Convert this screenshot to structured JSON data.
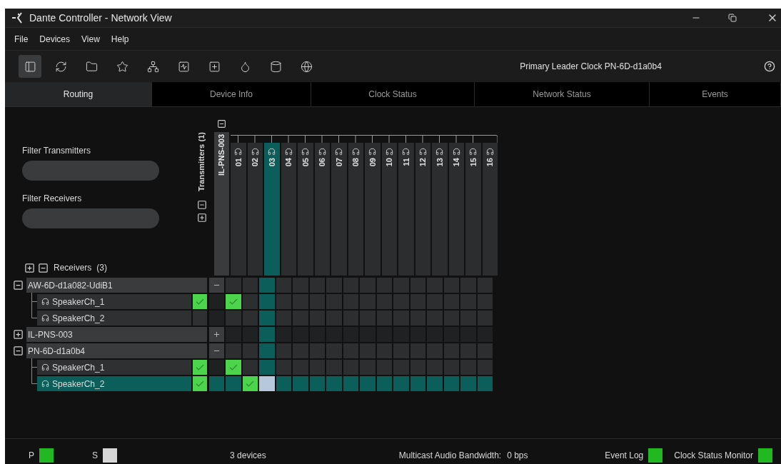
{
  "window": {
    "title": "Dante Controller - Network View"
  },
  "menu": [
    "File",
    "Devices",
    "View",
    "Help"
  ],
  "toolbar": {
    "tools": [
      {
        "kind": "panel",
        "selected": true
      },
      {
        "kind": "refresh",
        "selected": false
      },
      {
        "kind": "folder",
        "selected": false
      },
      {
        "kind": "star",
        "selected": false
      },
      {
        "kind": "network",
        "selected": false
      },
      {
        "kind": "monitor",
        "selected": false
      },
      {
        "kind": "add",
        "selected": false
      },
      {
        "kind": "drop",
        "selected": false
      },
      {
        "kind": "disc",
        "selected": false
      },
      {
        "kind": "globe",
        "selected": false
      }
    ],
    "clock_label": "Primary Leader Clock PN-6D-d1a0b4"
  },
  "tabs": [
    {
      "label": "Routing",
      "selected": true
    },
    {
      "label": "Device Info",
      "selected": false
    },
    {
      "label": "Clock Status",
      "selected": false
    },
    {
      "label": "Network Status",
      "selected": false
    },
    {
      "label": "Events",
      "selected": false
    }
  ],
  "filters": [
    {
      "label": "Filter Transmitters"
    },
    {
      "label": "Filter Receivers"
    }
  ],
  "transmitters": {
    "label": "Transmitters",
    "count": "(1)",
    "devices": [
      {
        "name": "IL-PNS-003",
        "expanded": true,
        "channels": [
          {
            "label": "01",
            "selected": false
          },
          {
            "label": "02",
            "selected": false
          },
          {
            "label": "03",
            "selected": true
          },
          {
            "label": "04",
            "selected": false
          },
          {
            "label": "05",
            "selected": false
          },
          {
            "label": "06",
            "selected": false
          },
          {
            "label": "07",
            "selected": false
          },
          {
            "label": "08",
            "selected": false
          },
          {
            "label": "09",
            "selected": false
          },
          {
            "label": "10",
            "selected": false
          },
          {
            "label": "11",
            "selected": false
          },
          {
            "label": "12",
            "selected": false
          },
          {
            "label": "13",
            "selected": false
          },
          {
            "label": "14",
            "selected": false
          },
          {
            "label": "15",
            "selected": false
          },
          {
            "label": "16",
            "selected": false
          }
        ]
      }
    ]
  },
  "receivers": {
    "label": "Receivers",
    "count": "(3)",
    "devices": [
      {
        "name": "AW-6D-d1a082-UdiB1",
        "expanded": true,
        "channels": [
          {
            "name": "SpeakerCh_1",
            "selected": false,
            "connected": true,
            "routes": [
              true,
              false,
              false,
              false,
              false,
              false,
              false,
              false,
              false,
              false,
              false,
              false,
              false,
              false,
              false,
              false
            ]
          },
          {
            "name": "SpeakerCh_2",
            "selected": false,
            "connected": false,
            "routes": [
              false,
              false,
              false,
              false,
              false,
              false,
              false,
              false,
              false,
              false,
              false,
              false,
              false,
              false,
              false,
              false
            ]
          }
        ]
      },
      {
        "name": "IL-PNS-003",
        "expanded": false
      },
      {
        "name": "PN-6D-d1a0b4",
        "expanded": true,
        "channels": [
          {
            "name": "SpeakerCh_1",
            "selected": false,
            "connected": true,
            "routes": [
              true,
              false,
              false,
              false,
              false,
              false,
              false,
              false,
              false,
              false,
              false,
              false,
              false,
              false,
              false,
              false
            ]
          },
          {
            "name": "SpeakerCh_2",
            "selected": true,
            "connected": true,
            "routes": [
              false,
              true,
              false,
              false,
              false,
              false,
              false,
              false,
              false,
              false,
              false,
              false,
              false,
              false,
              false,
              false
            ]
          }
        ]
      }
    ]
  },
  "status_bar": {
    "indicators": [
      {
        "label": "P",
        "color": "#22b822"
      },
      {
        "label": "S",
        "color": "#d6d6d6"
      }
    ],
    "device_count": "3 devices",
    "bandwidth_label": "Multicast Audio Bandwidth:",
    "bandwidth_value": "0 bps",
    "monitors": [
      {
        "label": "Event Log",
        "color": "#22b822"
      },
      {
        "label": "Clock Status Monitor",
        "color": "#22b822"
      }
    ]
  }
}
